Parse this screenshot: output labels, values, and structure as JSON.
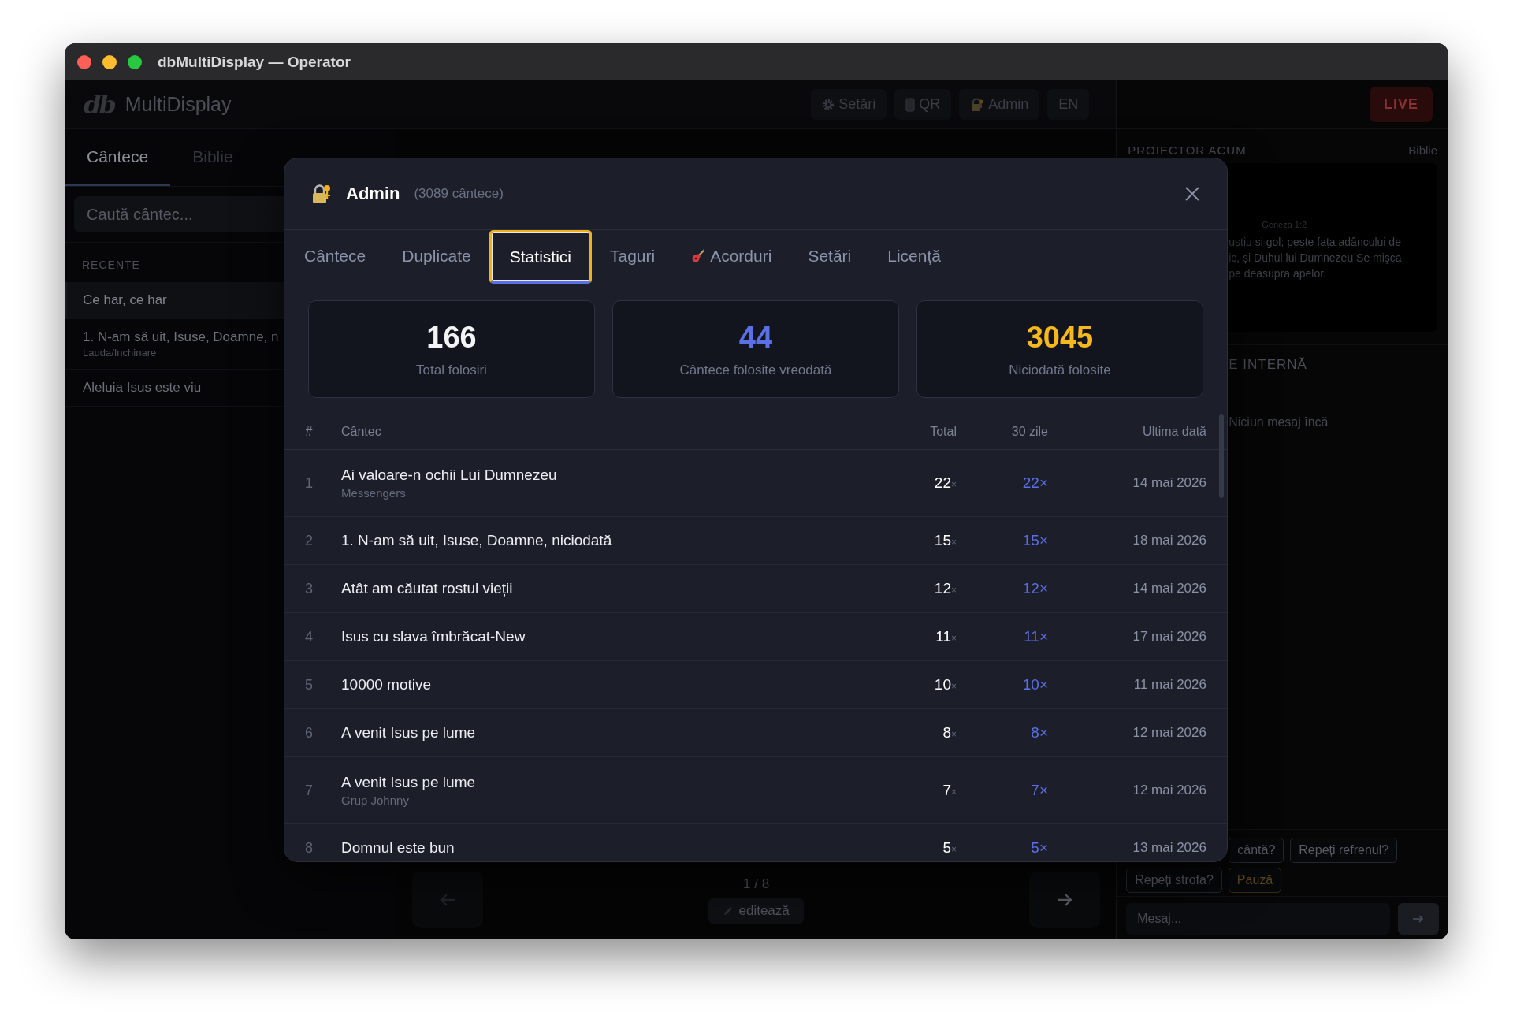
{
  "window": {
    "title": "dbMultiDisplay — Operator"
  },
  "header": {
    "logo": "db",
    "app_name": "MultiDisplay",
    "buttons": [
      {
        "kind": "settings",
        "label": "Setări"
      },
      {
        "kind": "qr",
        "label": "QR"
      },
      {
        "kind": "admin",
        "label": "Admin"
      },
      {
        "kind": "lang",
        "label": "EN"
      }
    ],
    "live": "LIVE"
  },
  "sidebar": {
    "tabs": [
      {
        "label": "Cântece",
        "selected": true
      },
      {
        "label": "Biblie",
        "selected": false
      }
    ],
    "search": {
      "placeholder": "Caută cântec..."
    },
    "recent_heading": "RECENTE",
    "recent": [
      {
        "title": "Ce har, ce har",
        "selected": true
      },
      {
        "title": "1. N-am să uit, Isuse, Doamne, n",
        "subtitle": "Lauda/Inchinare",
        "selected": false
      },
      {
        "title": "Aleluia Isus este viu",
        "selected": false
      }
    ]
  },
  "center": {
    "position": "1 / 8",
    "edit_button": "editează"
  },
  "right_panel": {
    "projector_heading": "PROIECTOR ACUM",
    "projector_source": "Biblie",
    "reference": "Geneza 1:2",
    "verse_lines": [
      "ustiu și gol; peste fața adâncului de",
      "ic, și Duhul lui Dumnezeu Se mişca",
      "pe deasupra apelor."
    ],
    "messages_heading": "E INTERNĂ",
    "empty_messages": "Niciun mesaj încă",
    "quick_replies": [
      {
        "label": "cântă?",
        "kind": "normal"
      },
      {
        "label": "Repeți refrenul?",
        "kind": "normal"
      },
      {
        "label": "Repeți strofa?",
        "kind": "normal"
      },
      {
        "label": "Pauză",
        "kind": "pause"
      }
    ],
    "message_input": {
      "placeholder": "Mesaj..."
    }
  },
  "modal": {
    "title": "Admin",
    "count": "(3089 cântece)",
    "tabs": [
      {
        "label": "Cântece",
        "kind": "plain",
        "selected": false
      },
      {
        "label": "Duplicate",
        "kind": "plain",
        "selected": false
      },
      {
        "label": "Statistici",
        "kind": "plain",
        "selected": true
      },
      {
        "label": "Taguri",
        "kind": "plain",
        "selected": false
      },
      {
        "label": "Acorduri",
        "kind": "guitar",
        "selected": false
      },
      {
        "label": "Setări",
        "kind": "plain",
        "selected": false
      },
      {
        "label": "Licență",
        "kind": "plain",
        "selected": false
      }
    ],
    "stats": [
      {
        "value": "166",
        "label": "Total folosiri",
        "color": "#f3f4f6"
      },
      {
        "value": "44",
        "label": "Cântece folosite vreodată",
        "color": "#5b6fe6"
      },
      {
        "value": "3045",
        "label": "Niciodată folosite",
        "color": "#f6b81a"
      }
    ],
    "table": {
      "columns": [
        "#",
        "Cântec",
        "Total",
        "30 zile",
        "Ultima dată"
      ],
      "rows": [
        {
          "rank": "1",
          "title": "Ai valoare-n ochii Lui Dumnezeu",
          "subtitle": "Messengers",
          "total": "22",
          "total_suffix": "×",
          "last_30_days": "22×",
          "last_date": "14 mai 2026"
        },
        {
          "rank": "2",
          "title": "1. N-am să uit, Isuse, Doamne, niciodată",
          "total": "15",
          "total_suffix": "×",
          "last_30_days": "15×",
          "last_date": "18 mai 2026"
        },
        {
          "rank": "3",
          "title": "Atât am căutat rostul vieții",
          "total": "12",
          "total_suffix": "×",
          "last_30_days": "12×",
          "last_date": "14 mai 2026"
        },
        {
          "rank": "4",
          "title": "Isus cu slava îmbrăcat-New",
          "total": "11",
          "total_suffix": "×",
          "last_30_days": "11×",
          "last_date": "17 mai 2026"
        },
        {
          "rank": "5",
          "title": "10000 motive",
          "total": "10",
          "total_suffix": "×",
          "last_30_days": "10×",
          "last_date": "11 mai 2026"
        },
        {
          "rank": "6",
          "title": "A venit Isus pe lume",
          "total": "8",
          "total_suffix": "×",
          "last_30_days": "8×",
          "last_date": "12 mai 2026"
        },
        {
          "rank": "7",
          "title": "A venit Isus pe lume",
          "subtitle": "Grup Johnny",
          "total": "7",
          "total_suffix": "×",
          "last_30_days": "7×",
          "last_date": "12 mai 2026"
        },
        {
          "rank": "8",
          "title": "Domnul este bun",
          "total": "5",
          "total_suffix": "×",
          "last_30_days": "5×",
          "last_date": "13 mai 2026"
        }
      ]
    }
  }
}
